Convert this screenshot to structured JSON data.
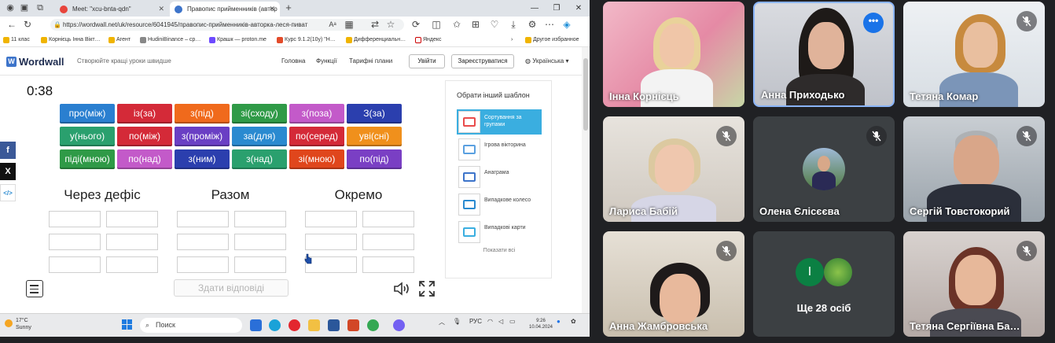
{
  "browser": {
    "tabs": [
      {
        "title": "Meet: \"xcu-bnta-qdn\"",
        "color": "#e8453c"
      },
      {
        "title": "Правопис прийменників (автор",
        "color": "#3d74ca"
      }
    ],
    "url": "https://wordwall.net/uk/resource/6041945/правопис-прийменників-авторка-леся-пиват",
    "bookmarks": [
      "11 клас",
      "Корнієць Інна Вікт…",
      "Агент",
      "HudiniBinance – cp…",
      "Крашк — proton.me",
      "Курс 9.1.2(10у) \"Н…",
      "Дифференциальн…",
      "Яндекс",
      "Другое избранное"
    ]
  },
  "wordwall": {
    "logo": "Wordwall",
    "tagline": "Створюйте кращі уроки швидше",
    "nav": [
      "Головна",
      "Функції",
      "Тарифні плани"
    ],
    "login": "Увійти",
    "register": "Зареєструватися",
    "language": "Українська"
  },
  "activity": {
    "timer": "0:38",
    "tiles": [
      {
        "text": "про(між)",
        "color": "#2a7fd0"
      },
      {
        "text": "із(за)",
        "color": "#d42a38"
      },
      {
        "text": "з(під)",
        "color": "#f06a1c"
      },
      {
        "text": "зі(сходу)",
        "color": "#2f9a47"
      },
      {
        "text": "з(поза)",
        "color": "#c35ac9"
      },
      {
        "text": "З(за)",
        "color": "#2b3fae"
      },
      {
        "text": "у(нього)",
        "color": "#2aa06e"
      },
      {
        "text": "по(між)",
        "color": "#d42a38"
      },
      {
        "text": "з(проміж)",
        "color": "#6a3fc4"
      },
      {
        "text": "за(для)",
        "color": "#2a8ad0"
      },
      {
        "text": "по(серед)",
        "color": "#d42a38"
      },
      {
        "text": "уві(сні)",
        "color": "#f0901c"
      },
      {
        "text": "піді(мною)",
        "color": "#2f9a47"
      },
      {
        "text": "по(над)",
        "color": "#c35ac9"
      },
      {
        "text": "з(ним)",
        "color": "#2b3fae"
      },
      {
        "text": "з(над)",
        "color": "#2aa06e"
      },
      {
        "text": "зі(мною)",
        "color": "#e0461c"
      },
      {
        "text": "по(під)",
        "color": "#7a3fc4"
      }
    ],
    "columns": [
      "Через дефіс",
      "Разом",
      "Окремо"
    ],
    "submit": "Здати відповіді"
  },
  "templates": {
    "title": "Обрати інший шаблон",
    "items": [
      {
        "label": "Сортування за групами",
        "selected": true
      },
      {
        "label": "Ігрова вікторина",
        "selected": false
      },
      {
        "label": "Анаграма",
        "selected": false
      },
      {
        "label": "Випадкове колесо",
        "selected": false
      },
      {
        "label": "Випадкові карти",
        "selected": false
      }
    ],
    "more": "Показати всі"
  },
  "share": [
    "f",
    "X",
    "</>"
  ],
  "taskbar": {
    "weather_temp": "17°C",
    "weather_desc": "Sunny",
    "search": "Поиск",
    "lang": "РУС",
    "time": "9:26",
    "date": "10.04.2024"
  },
  "participants": [
    {
      "name": "Інна Корнієць",
      "muted": false,
      "speaking": false
    },
    {
      "name": "Анна Приходько",
      "muted": false,
      "speaking": true
    },
    {
      "name": "Тетяна Комар",
      "muted": true,
      "speaking": false
    },
    {
      "name": "Лариса Бабій",
      "muted": true,
      "speaking": false
    },
    {
      "name": "Олена Єлісєєва",
      "muted": true,
      "speaking": false
    },
    {
      "name": "Сергій Товстокорий",
      "muted": true,
      "speaking": false
    },
    {
      "name": "Анна Жамбровська",
      "muted": true,
      "speaking": false
    },
    {
      "name": "Ще 28 осіб",
      "muted": false,
      "speaking": false
    },
    {
      "name": "Тетяна Сергіївна Ба…",
      "muted": true,
      "speaking": false
    }
  ],
  "more_avatar_letter": "І"
}
